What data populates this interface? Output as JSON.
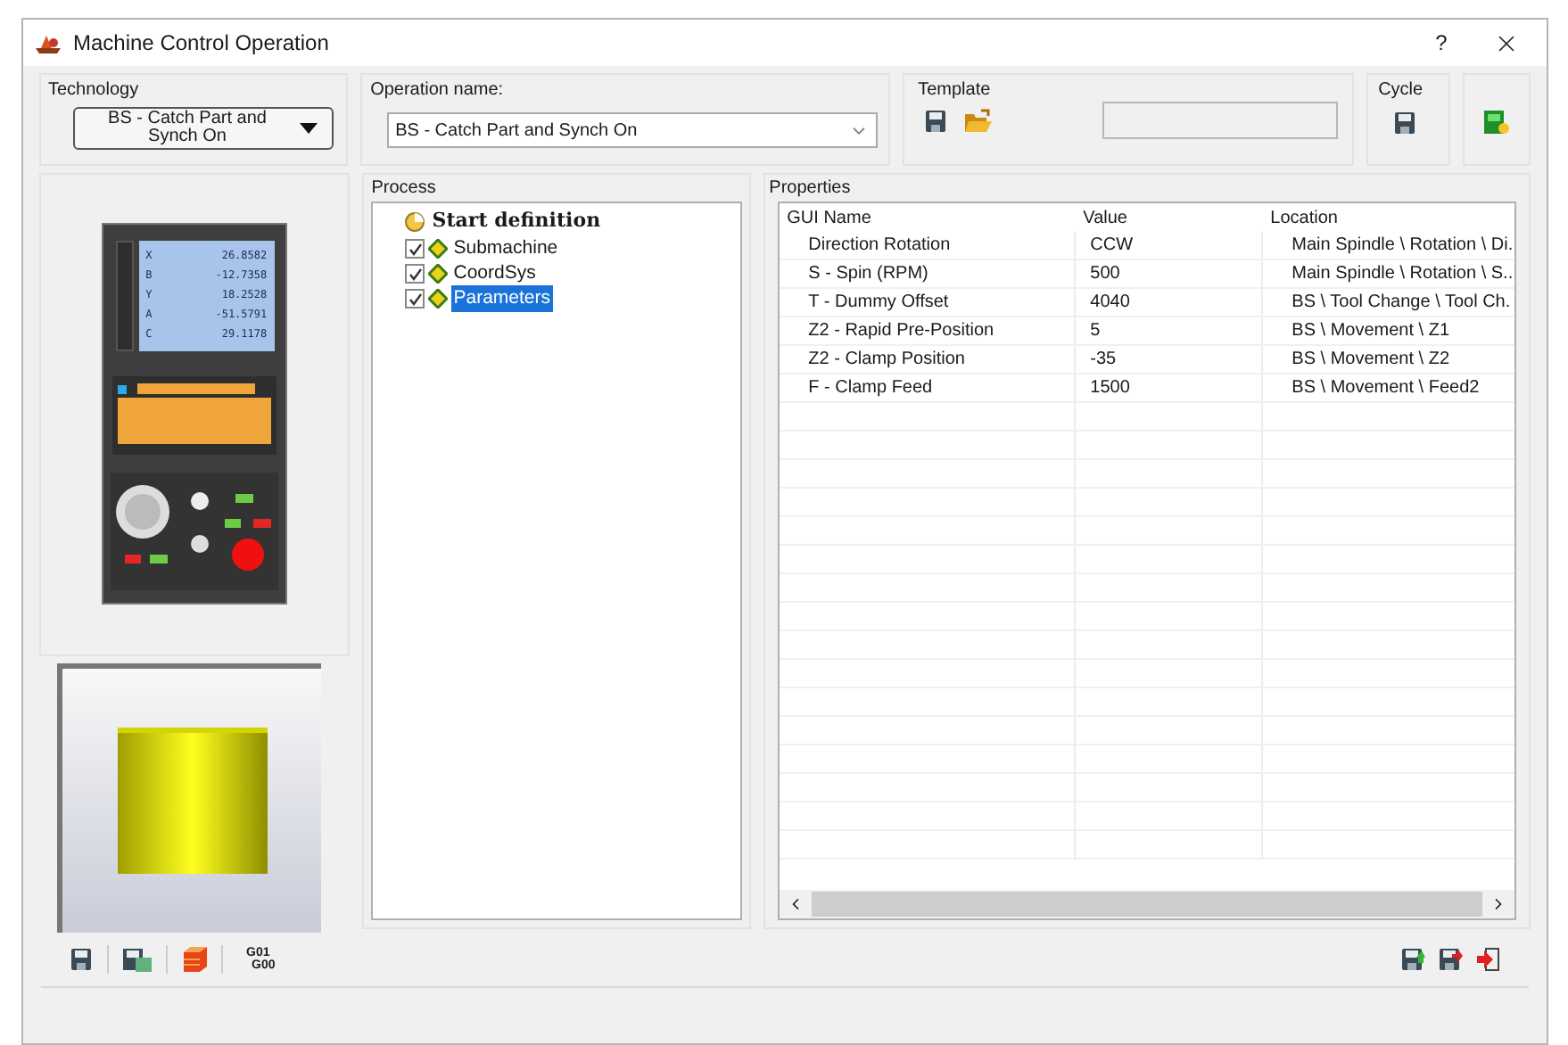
{
  "window": {
    "title": "Machine Control Operation",
    "help": "?"
  },
  "technology": {
    "label": "Technology",
    "value": "BS - Catch Part and Synch On"
  },
  "operation": {
    "label": "Operation name:",
    "value": "BS - Catch Part and Synch On"
  },
  "template": {
    "label": "Template"
  },
  "cycle": {
    "label": "Cycle"
  },
  "controller_display": [
    {
      "axis": "X",
      "value": "26.8582"
    },
    {
      "axis": "B",
      "value": "-12.7358"
    },
    {
      "axis": "Y",
      "value": "18.2528"
    },
    {
      "axis": "A",
      "value": "-51.5791"
    },
    {
      "axis": "C",
      "value": "29.1178"
    }
  ],
  "process": {
    "label": "Process",
    "tree": {
      "label": "Start definition",
      "children": [
        {
          "label": "Submachine",
          "checked": true,
          "selected": false
        },
        {
          "label": "CoordSys",
          "checked": true,
          "selected": false
        },
        {
          "label": "Parameters",
          "checked": true,
          "selected": true
        }
      ]
    }
  },
  "properties": {
    "label": "Properties",
    "columns": [
      "GUI Name",
      "Value",
      "Location"
    ],
    "rows": [
      [
        "Direction Rotation",
        "CCW",
        "Main Spindle \\ Rotation \\ Di."
      ],
      [
        "S - Spin (RPM)",
        "500",
        "Main Spindle \\ Rotation \\ S.."
      ],
      [
        "T - Dummy Offset",
        "4040",
        "BS \\ Tool Change \\ Tool Ch."
      ],
      [
        "Z2 - Rapid Pre-Position",
        "5",
        "BS \\ Movement \\ Z1"
      ],
      [
        "Z2 - Clamp Position",
        "-35",
        "BS \\ Movement \\ Z2"
      ],
      [
        "F - Clamp Feed",
        "1500",
        "BS \\ Movement \\ Feed2"
      ]
    ]
  },
  "gcode_button": {
    "line_1": "G01",
    "line_2": "G00"
  }
}
